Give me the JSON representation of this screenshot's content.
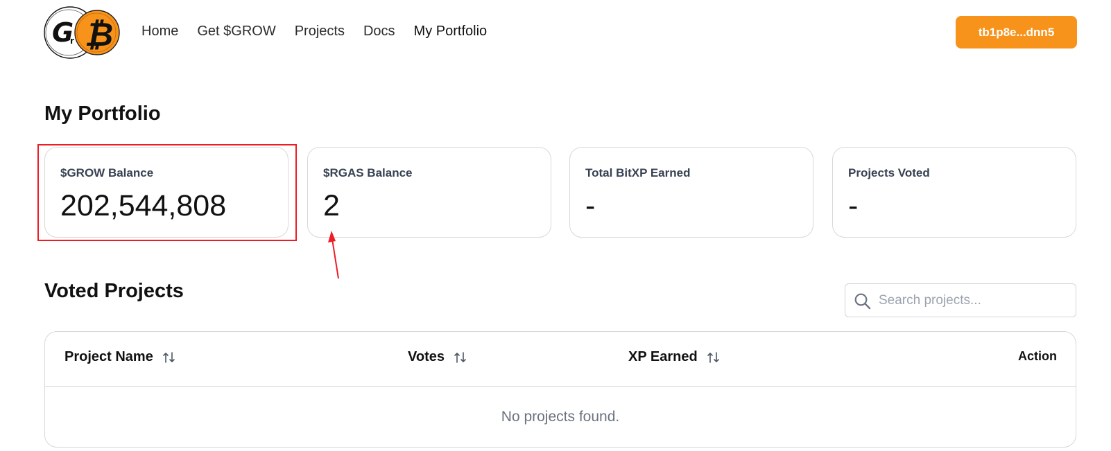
{
  "header": {
    "logo": {
      "icon": "grow-bitcoin-logo-icon",
      "letter_left": "G",
      "letter_subscript": "r",
      "letter_right": "₿",
      "colors": {
        "white_coin": "#ffffff",
        "orange_coin": "#f7931a",
        "outline": "#111111"
      }
    },
    "nav": [
      {
        "label": "Home",
        "active": false
      },
      {
        "label": "Get $GROW",
        "active": false
      },
      {
        "label": "Projects",
        "active": false
      },
      {
        "label": "Docs",
        "active": false
      },
      {
        "label": "My Portfolio",
        "active": true
      }
    ],
    "wallet_button": {
      "label": "tb1p8e...dnn5",
      "color": "#f7931a"
    }
  },
  "portfolio": {
    "title": "My Portfolio",
    "cards": [
      {
        "label": "$GROW Balance",
        "value": "202,544,808",
        "highlighted": true
      },
      {
        "label": "$RGAS Balance",
        "value": "2",
        "annotation": "red-arrow-up"
      },
      {
        "label": "Total BitXP Earned",
        "value": "-"
      },
      {
        "label": "Projects Voted",
        "value": "-"
      }
    ],
    "annotation_color": "#ee1c24"
  },
  "voted_projects": {
    "title": "Voted Projects",
    "search": {
      "placeholder": "Search projects...",
      "value": "",
      "icon": "search-icon"
    },
    "table": {
      "columns": [
        {
          "label": "Project Name",
          "sortable": true,
          "sort_icon": "sort-icon"
        },
        {
          "label": "Votes",
          "sortable": true,
          "sort_icon": "sort-icon"
        },
        {
          "label": "XP Earned",
          "sortable": true,
          "sort_icon": "sort-icon"
        },
        {
          "label": "Action",
          "sortable": false
        }
      ],
      "rows": [],
      "empty_message": "No projects found."
    }
  }
}
